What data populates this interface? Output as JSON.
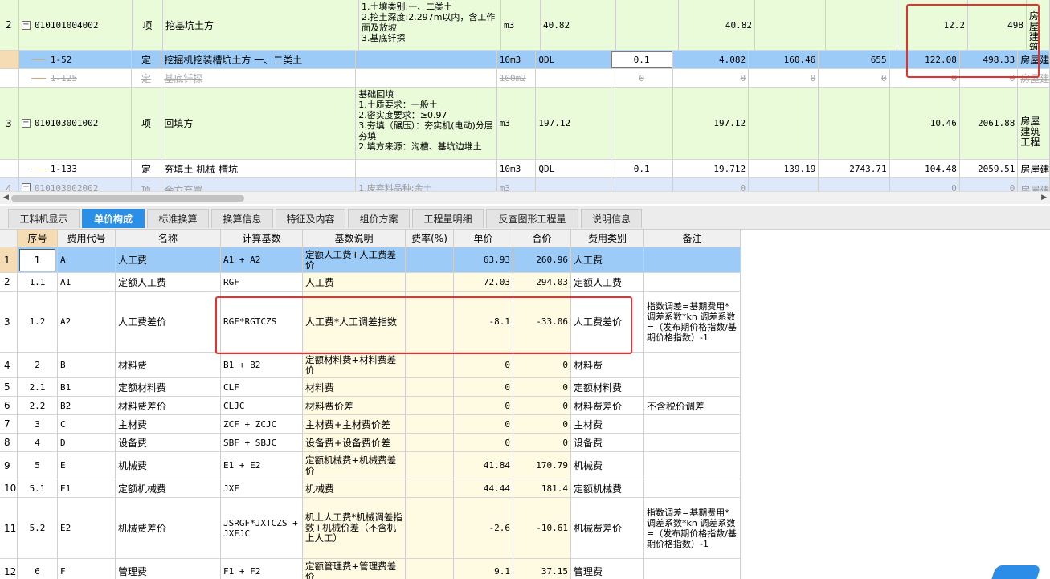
{
  "top_rows": [
    {
      "num": "2",
      "code": "010101004002",
      "type": "项",
      "name": "挖基坑土方",
      "feature_lines": [
        "1.土壤类别:一、二类土",
        "2.挖土深度:2.297m以内，含工作面及放坡",
        "3.基底钎探"
      ],
      "unit": "m3",
      "expr": "40.82",
      "qty": "",
      "qty2": "40.82",
      "c1": "",
      "c2": "",
      "price": "12.2",
      "total": "498",
      "category": "房屋建筑工程"
    },
    {
      "num": "",
      "code": "1-52",
      "type": "定",
      "name": "挖掘机挖装槽坑土方 一、二类土",
      "feature_lines": [],
      "unit": "10m3",
      "expr": "QDL",
      "qty": "0.1",
      "qty2": "4.082",
      "c1": "160.46",
      "c2": "655",
      "price": "122.08",
      "total": "498.33",
      "category": "房屋建"
    },
    {
      "num": "",
      "code": "1-125",
      "type": "定",
      "name": "基底钎探",
      "feature_lines": [],
      "unit": "100m2",
      "expr": "",
      "qty": "0",
      "qty2": "0",
      "c1": "0",
      "c2": "0",
      "price": "0",
      "total": "0",
      "category": "房屋建"
    },
    {
      "num": "3",
      "code": "010103001002",
      "type": "项",
      "name": "回填方",
      "feature_lines": [
        "基础回填",
        "1.土质要求：一般土",
        "2.密实度要求：≥0.97",
        "3.夯填（碾压）：夯实机(电动)分层夯填",
        "2.填方来源：沟槽、基坑边堆土"
      ],
      "unit": "m3",
      "expr": "197.12",
      "qty": "",
      "qty2": "197.12",
      "c1": "",
      "c2": "",
      "price": "10.46",
      "total": "2061.88",
      "category": "房屋建筑工程"
    },
    {
      "num": "",
      "code": "1-133",
      "type": "定",
      "name": "夯填土 机械 槽坑",
      "feature_lines": [],
      "unit": "10m3",
      "expr": "QDL",
      "qty": "0.1",
      "qty2": "19.712",
      "c1": "139.19",
      "c2": "2743.71",
      "price": "104.48",
      "total": "2059.51",
      "category": "房屋建"
    },
    {
      "num": "4",
      "code": "010103002002",
      "type": "项",
      "name": "余方弃置",
      "feature_lines": [
        "1.废弃料品种:余土"
      ],
      "unit": "m3",
      "expr": "",
      "qty": "",
      "qty2": "0",
      "c1": "",
      "c2": "",
      "price": "0",
      "total": "0",
      "category": "房屋建"
    }
  ],
  "tabs": [
    "工料机显示",
    "单价构成",
    "标准换算",
    "换算信息",
    "特征及内容",
    "组价方案",
    "工程量明细",
    "反查图形工程量",
    "说明信息"
  ],
  "active_tab": "单价构成",
  "bottom_headers": [
    "序号",
    "费用代号",
    "名称",
    "计算基数",
    "基数说明",
    "费率(%)",
    "单价",
    "合价",
    "费用类别",
    "备注"
  ],
  "bottom_rows": [
    {
      "n": "1",
      "seq": "1",
      "code": "A",
      "name": "人工费",
      "base": "A1 + A2",
      "desc": "定额人工费+人工费差价",
      "rate": "",
      "price": "63.93",
      "total": "260.96",
      "cat": "人工费",
      "note": ""
    },
    {
      "n": "2",
      "seq": "1.1",
      "code": "A1",
      "name": "定额人工费",
      "base": "RGF",
      "desc": "人工费",
      "rate": "",
      "price": "72.03",
      "total": "294.03",
      "cat": "定额人工费",
      "note": ""
    },
    {
      "n": "3",
      "seq": "1.2",
      "code": "A2",
      "name": "人工费差价",
      "base": "RGF*RGTCZS",
      "desc": "人工费*人工调差指数",
      "rate": "",
      "price": "-8.1",
      "total": "-33.06",
      "cat": "人工费差价",
      "note": "指数调差=基期费用*调差系数*kn 调差系数=（发布期价格指数/基期价格指数）-1"
    },
    {
      "n": "4",
      "seq": "2",
      "code": "B",
      "name": "材料费",
      "base": "B1 + B2",
      "desc": "定额材料费+材料费差价",
      "rate": "",
      "price": "0",
      "total": "0",
      "cat": "材料费",
      "note": ""
    },
    {
      "n": "5",
      "seq": "2.1",
      "code": "B1",
      "name": "定额材料费",
      "base": "CLF",
      "desc": "材料费",
      "rate": "",
      "price": "0",
      "total": "0",
      "cat": "定额材料费",
      "note": ""
    },
    {
      "n": "6",
      "seq": "2.2",
      "code": "B2",
      "name": "材料费差价",
      "base": "CLJC",
      "desc": "材料费价差",
      "rate": "",
      "price": "0",
      "total": "0",
      "cat": "材料费差价",
      "note": "不含税价调差"
    },
    {
      "n": "7",
      "seq": "3",
      "code": "C",
      "name": "主材费",
      "base": "ZCF + ZCJC",
      "desc": "主材费+主材费价差",
      "rate": "",
      "price": "0",
      "total": "0",
      "cat": "主材费",
      "note": ""
    },
    {
      "n": "8",
      "seq": "4",
      "code": "D",
      "name": "设备费",
      "base": "SBF + SBJC",
      "desc": "设备费+设备费价差",
      "rate": "",
      "price": "0",
      "total": "0",
      "cat": "设备费",
      "note": ""
    },
    {
      "n": "9",
      "seq": "5",
      "code": "E",
      "name": "机械费",
      "base": "E1 + E2",
      "desc": "定额机械费+机械费差价",
      "rate": "",
      "price": "41.84",
      "total": "170.79",
      "cat": "机械费",
      "note": ""
    },
    {
      "n": "10",
      "seq": "5.1",
      "code": "E1",
      "name": "定额机械费",
      "base": "JXF",
      "desc": "机械费",
      "rate": "",
      "price": "44.44",
      "total": "181.4",
      "cat": "定额机械费",
      "note": ""
    },
    {
      "n": "11",
      "seq": "5.2",
      "code": "E2",
      "name": "机械费差价",
      "base": "JSRGF*JXTCZS + JXFJC",
      "desc": "机上人工费*机械调差指数+机械价差（不含机上人工）",
      "rate": "",
      "price": "-2.6",
      "total": "-10.61",
      "cat": "机械费差价",
      "note": "指数调差=基期费用*调差系数*kn 调差系数=（发布期价格指数/基期价格指数）-1"
    },
    {
      "n": "12",
      "seq": "6",
      "code": "F",
      "name": "管理费",
      "base": "F1 + F2",
      "desc": "定额管理费+管理费差价",
      "rate": "",
      "price": "9.1",
      "total": "37.15",
      "cat": "管理费",
      "note": ""
    }
  ]
}
